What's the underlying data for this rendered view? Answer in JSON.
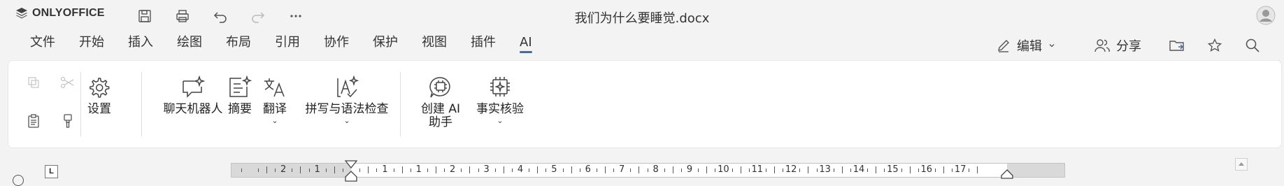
{
  "app": {
    "logo_text": "ONLYOFFICE"
  },
  "document": {
    "title": "我们为什么要睡觉.docx"
  },
  "quick_access": [
    {
      "name": "save-icon"
    },
    {
      "name": "print-icon"
    },
    {
      "name": "undo-icon"
    },
    {
      "name": "redo-icon"
    },
    {
      "name": "more-icon"
    }
  ],
  "menu": {
    "tabs": [
      "文件",
      "开始",
      "插入",
      "绘图",
      "布局",
      "引用",
      "协作",
      "保护",
      "视图",
      "插件",
      "AI"
    ],
    "active_tab": "AI"
  },
  "right_tools": {
    "edit_label": "编辑",
    "share_label": "分享"
  },
  "ribbon": {
    "settings": "设置",
    "chatbot": "聊天机器人",
    "summary": "摘要",
    "translate": "翻译",
    "spellcheck": "拼写与语法检查",
    "create_ai_line1": "创建 AI",
    "create_ai_line2": "助手",
    "fact_check": "事实核验"
  },
  "ruler": {
    "labels": [
      "2",
      "1",
      "1",
      "1",
      "2",
      "3",
      "4",
      "5",
      "6",
      "7",
      "8",
      "9",
      "10",
      "11",
      "12",
      "13",
      "14",
      "15",
      "16",
      "17"
    ]
  },
  "colors": {
    "accent": "#4a6b96",
    "background": "#f3f3f3",
    "ribbon": "#ffffff"
  }
}
